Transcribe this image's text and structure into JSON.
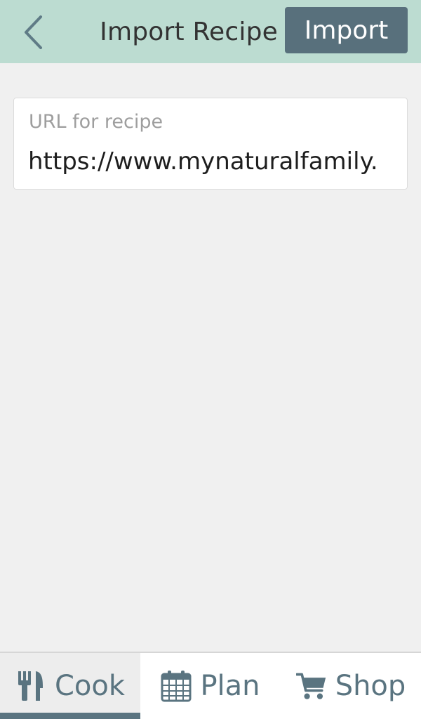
{
  "header": {
    "title": "Import Recipe",
    "import_label": "Import",
    "back_icon": "chevron-left-icon"
  },
  "url_field": {
    "label": "URL for recipe",
    "value": "https://www.mynaturalfamily."
  },
  "tabs": [
    {
      "label": "Cook",
      "icon": "utensils-icon",
      "active": true
    },
    {
      "label": "Plan",
      "icon": "calendar-icon",
      "active": false
    },
    {
      "label": "Shop",
      "icon": "cart-icon",
      "active": false
    }
  ],
  "colors": {
    "header_bg": "#bcdcd1",
    "accent": "#58707c",
    "page_bg": "#f0f0f0"
  }
}
